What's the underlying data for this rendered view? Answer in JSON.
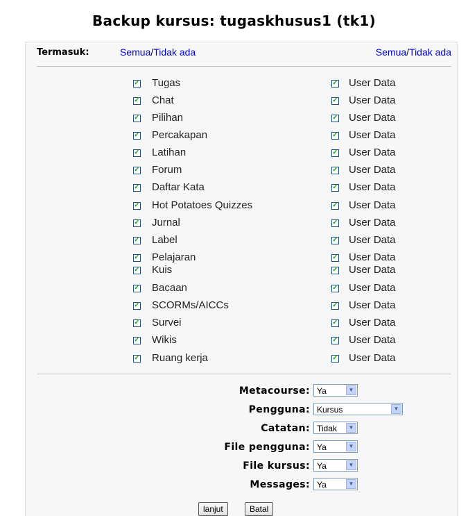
{
  "page": {
    "title": "Backup kursus: tugaskhusus1 (tk1)"
  },
  "include": {
    "label": "Termasuk:",
    "left": {
      "all": "Semua",
      "sep": "/",
      "none": "Tidak ada"
    },
    "right": {
      "all": "Semua",
      "sep": "/",
      "none": "Tidak ada"
    }
  },
  "modules": [
    {
      "name": "Tugas",
      "checked": true,
      "userdata": "User Data",
      "userdata_checked": true
    },
    {
      "name": "Chat",
      "checked": true,
      "userdata": "User Data",
      "userdata_checked": true
    },
    {
      "name": "Pilihan",
      "checked": true,
      "userdata": "User Data",
      "userdata_checked": true
    },
    {
      "name": "Percakapan",
      "checked": true,
      "userdata": "User Data",
      "userdata_checked": true
    },
    {
      "name": "Latihan",
      "checked": true,
      "userdata": "User Data",
      "userdata_checked": true
    },
    {
      "name": "Forum",
      "checked": true,
      "userdata": "User Data",
      "userdata_checked": true
    },
    {
      "name": "Daftar Kata",
      "checked": true,
      "userdata": "User Data",
      "userdata_checked": true
    },
    {
      "name": "Hot Potatoes Quizzes",
      "checked": true,
      "userdata": "User Data",
      "userdata_checked": true
    },
    {
      "name": "Jurnal",
      "checked": true,
      "userdata": "User Data",
      "userdata_checked": true
    },
    {
      "name": "Label",
      "checked": true,
      "userdata": "User Data",
      "userdata_checked": true
    },
    {
      "name": "Pelajaran",
      "checked": true,
      "userdata": "User Data",
      "userdata_checked": true
    },
    {
      "name": "Kuis",
      "checked": true,
      "userdata": "User Data",
      "userdata_checked": true
    },
    {
      "name": "Bacaan",
      "checked": true,
      "userdata": "User Data",
      "userdata_checked": true
    },
    {
      "name": "SCORMs/AICCs",
      "checked": true,
      "userdata": "User Data",
      "userdata_checked": true
    },
    {
      "name": "Survei",
      "checked": true,
      "userdata": "User Data",
      "userdata_checked": true
    },
    {
      "name": "Wikis",
      "checked": true,
      "userdata": "User Data",
      "userdata_checked": true
    },
    {
      "name": "Ruang kerja",
      "checked": true,
      "userdata": "User Data",
      "userdata_checked": true
    }
  ],
  "options": [
    {
      "label": "Metacourse:",
      "value": "Ya"
    },
    {
      "label": "Pengguna:",
      "value": "Kursus"
    },
    {
      "label": "Catatan:",
      "value": "Tidak"
    },
    {
      "label": "File pengguna:",
      "value": "Ya"
    },
    {
      "label": "File kursus:",
      "value": "Ya"
    },
    {
      "label": "Messages:",
      "value": "Ya"
    }
  ],
  "buttons": {
    "continue": "lanjut",
    "cancel": "Batal"
  },
  "icons": {
    "checkbox": "checkbox-checked-icon",
    "dropdown": "chevron-down-icon"
  },
  "colors": {
    "link": "#0000cc",
    "check": "#21a121"
  }
}
